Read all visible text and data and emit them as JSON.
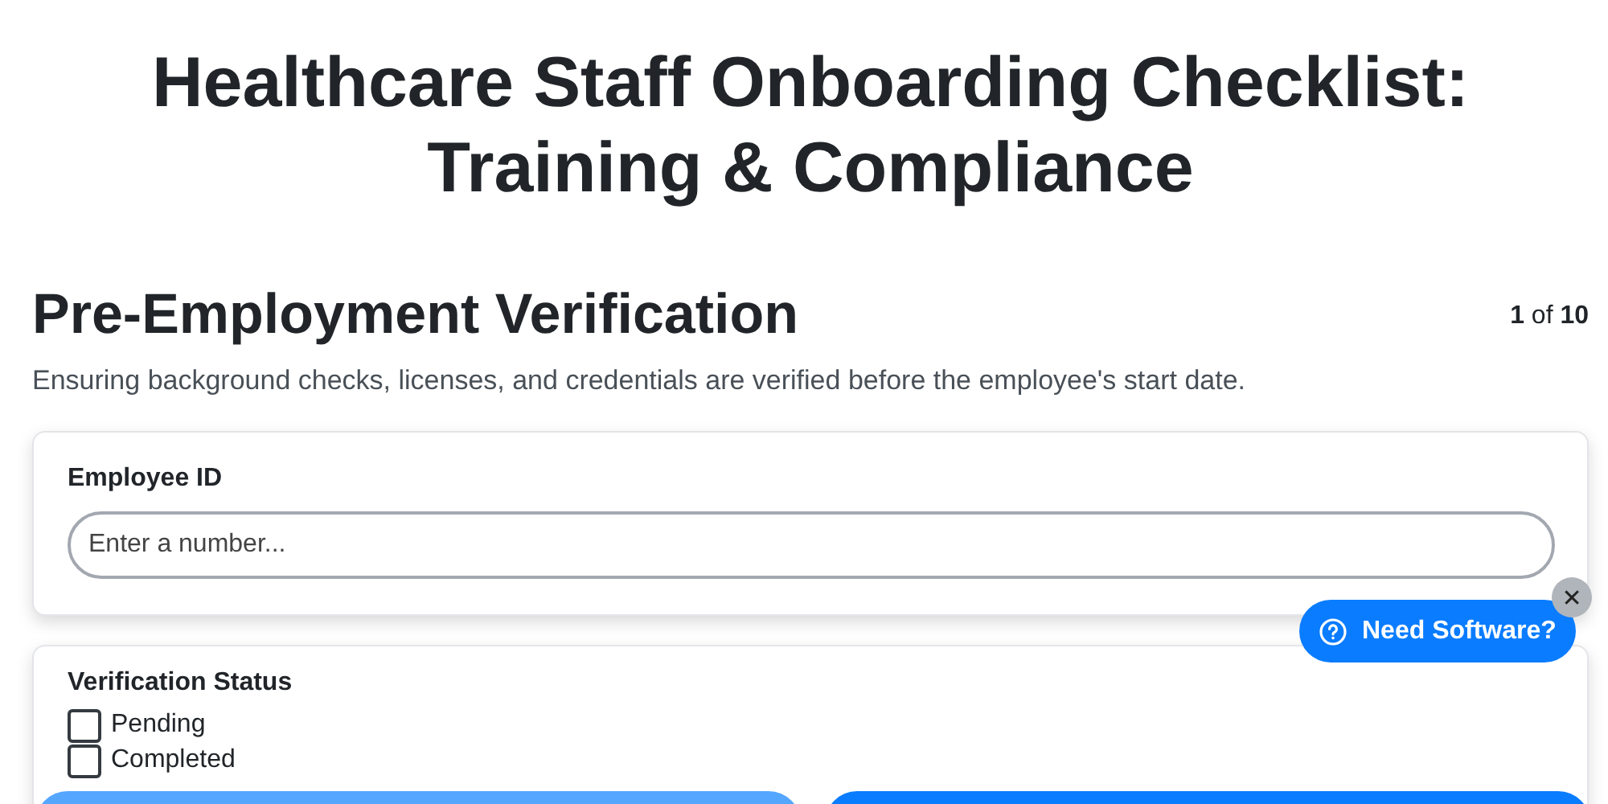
{
  "title": "Healthcare Staff Onboarding Checklist: Training & Compliance",
  "section": {
    "heading": "Pre-Employment Verification",
    "counter": "**1** of **10**",
    "description": "Ensuring background checks, licenses, and credentials are verified before the employee's start date."
  },
  "fields": [
    {
      "kind": "text",
      "label": "Employee ID",
      "placeholder": "Enter a number..."
    },
    {
      "kind": "checkboxes",
      "label": "Verification Status",
      "options": [
        {
          "label": "Pending",
          "checked": false
        },
        {
          "label": "Completed",
          "checked": false
        }
      ]
    }
  ],
  "nav_buttons": [
    {
      "disabled": true
    },
    {
      "disabled": false
    }
  ],
  "help_widget": {
    "label": "Need Software?",
    "close": "✕"
  }
}
